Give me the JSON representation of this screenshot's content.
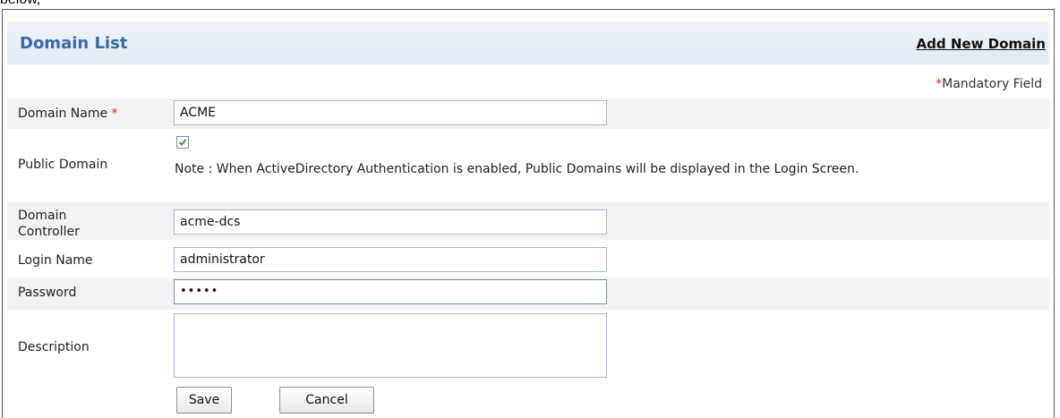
{
  "caption": "below,",
  "header": {
    "title": "Domain List",
    "add_link": "Add New Domain"
  },
  "mandatory_note": {
    "star": "*",
    "text": "Mandatory Field"
  },
  "form": {
    "domain_name": {
      "label": "Domain Name",
      "required_star": "*",
      "value": "ACME"
    },
    "public_domain": {
      "label": "Public Domain",
      "checked": true,
      "note": "Note : When ActiveDirectory Authentication is enabled, Public Domains will be displayed in the Login Screen."
    },
    "domain_controller": {
      "label_line1": "Domain",
      "label_line2": "Controller",
      "value": "acme-dcs"
    },
    "login_name": {
      "label": "Login Name",
      "value": "administrator"
    },
    "password": {
      "label": "Password",
      "masked_value": "•••••"
    },
    "description": {
      "label": "Description",
      "value": ""
    }
  },
  "buttons": {
    "save": "Save",
    "cancel": "Cancel"
  }
}
